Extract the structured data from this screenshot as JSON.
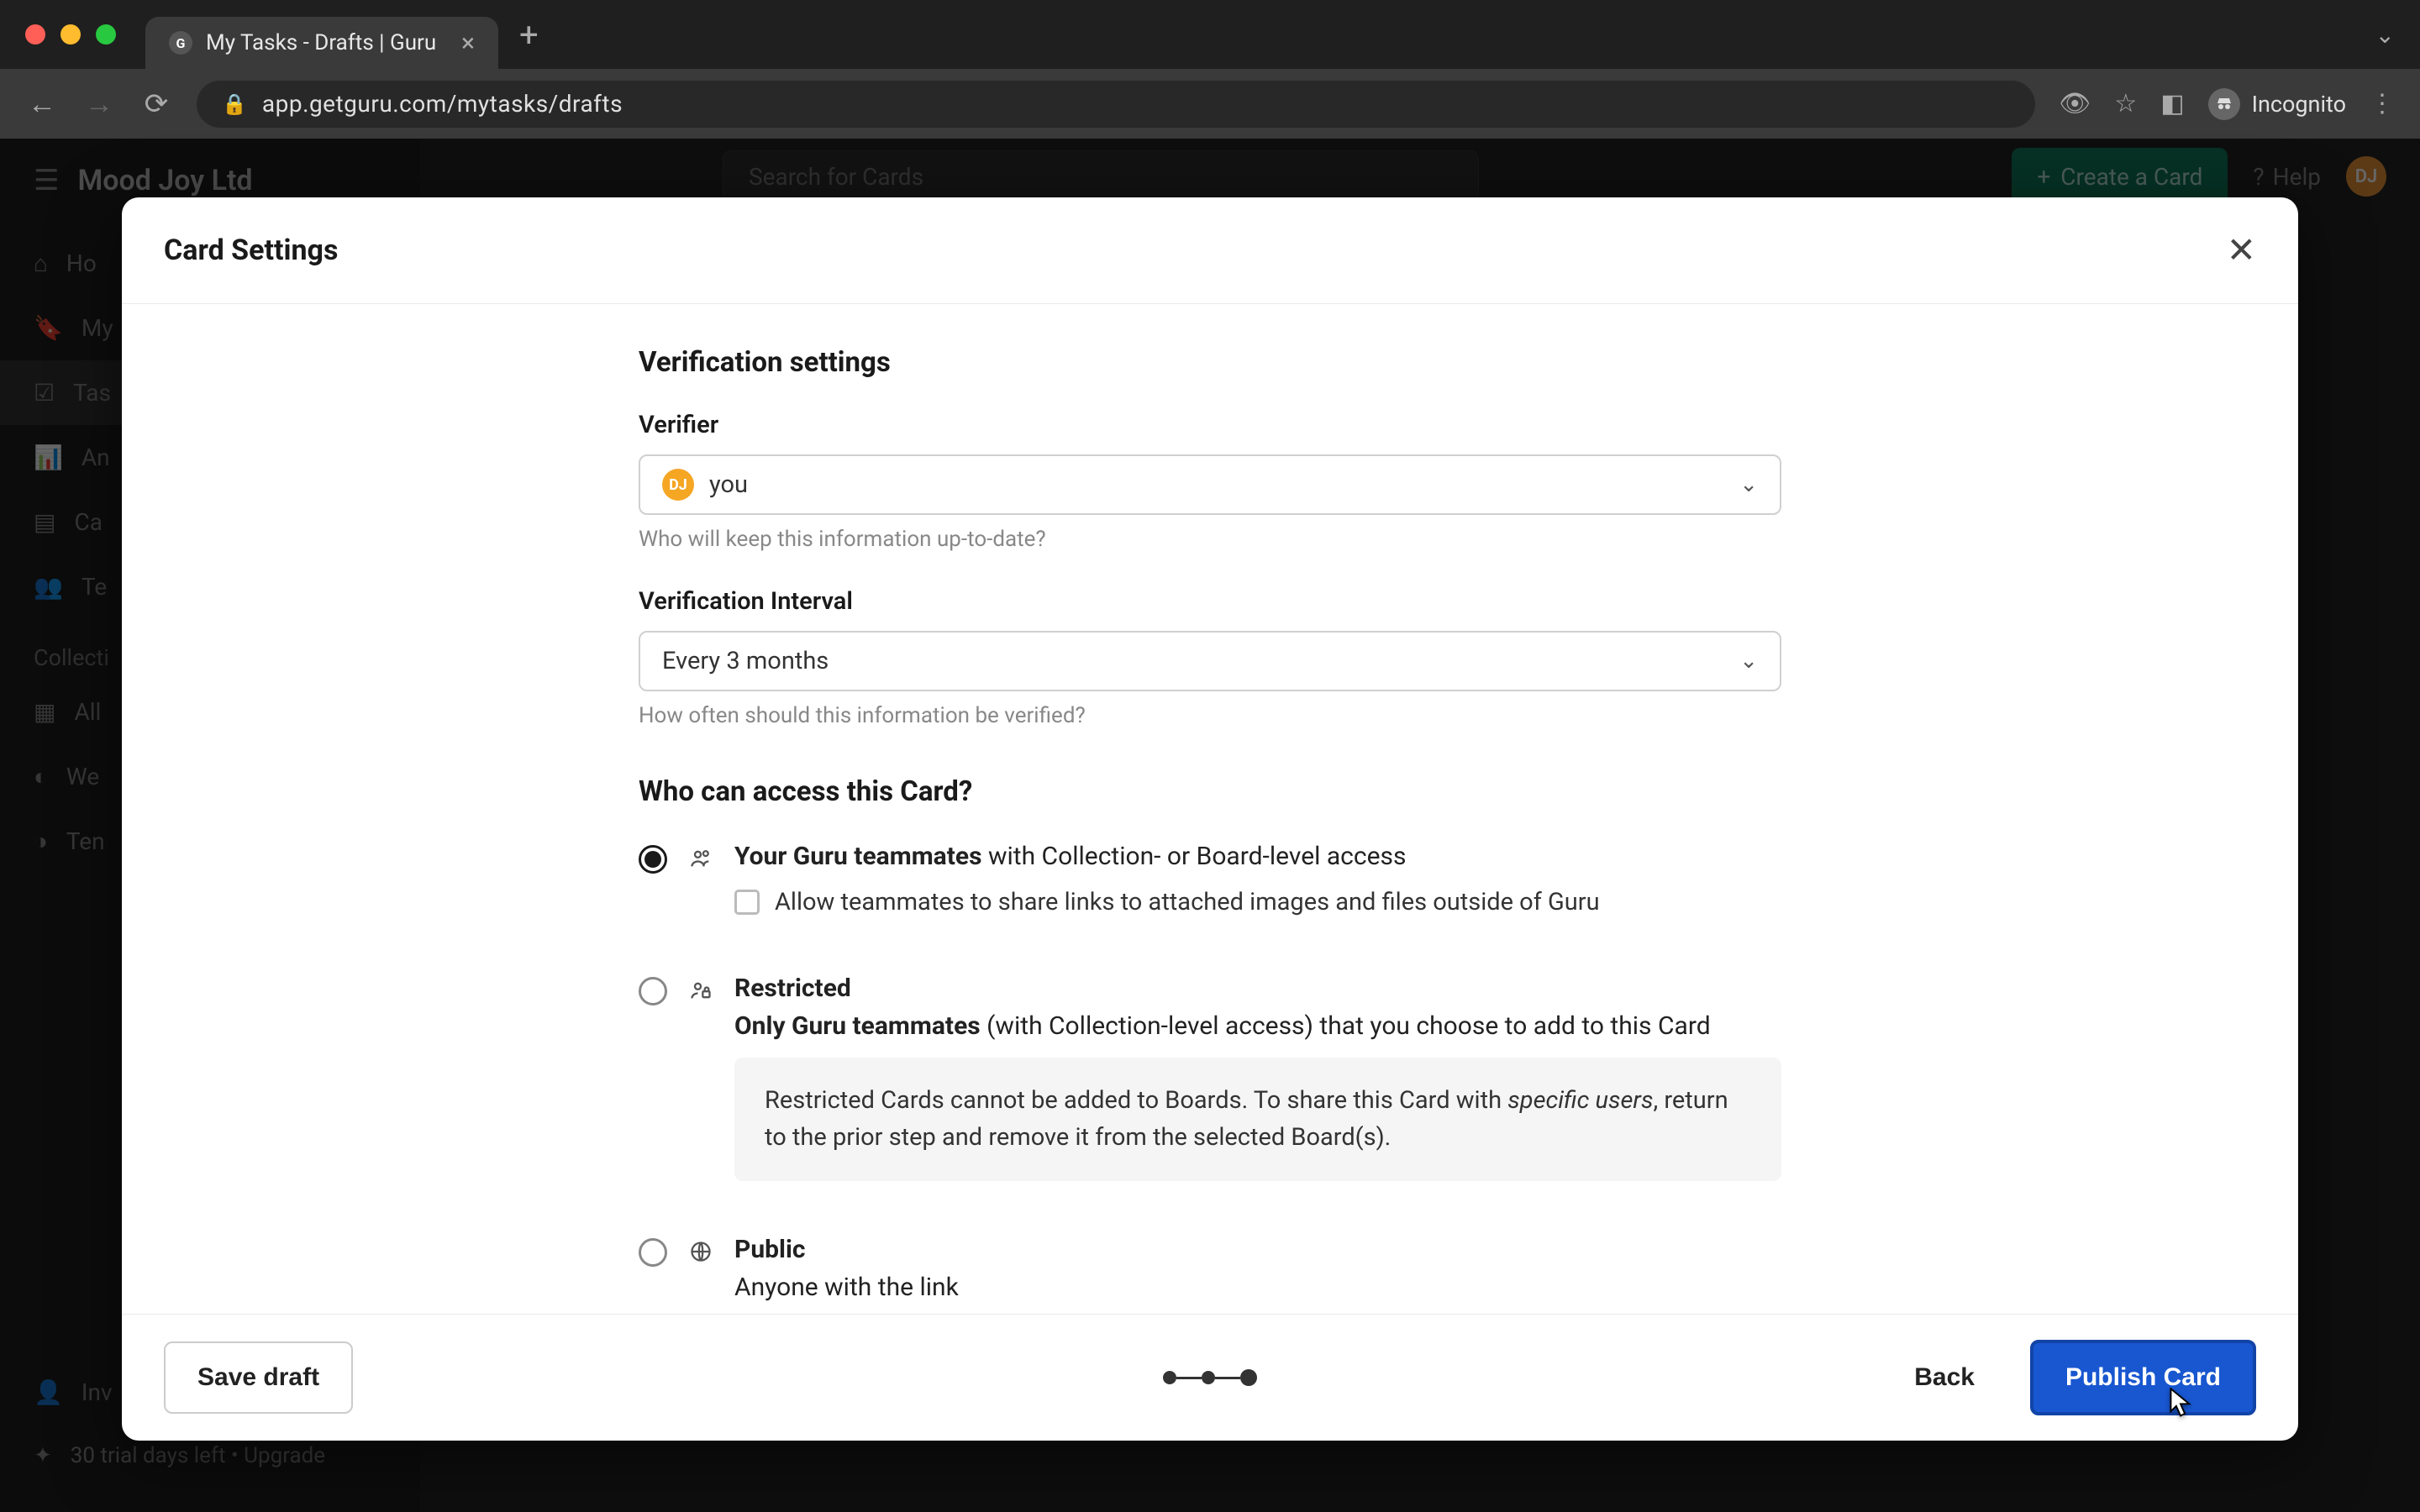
{
  "browser": {
    "tab_title": "My Tasks - Drafts | Guru",
    "favicon_letter": "G",
    "url": "app.getguru.com/mytasks/drafts",
    "incognito_label": "Incognito"
  },
  "app": {
    "brand": "Mood Joy Ltd",
    "search_placeholder": "Search for Cards",
    "create_label": "Create a Card",
    "help_label": "Help",
    "avatar_initials": "DJ",
    "sidebar": {
      "items": [
        {
          "label": "Ho",
          "icon": "home"
        },
        {
          "label": "My",
          "icon": "bookmark"
        },
        {
          "label": "Tas",
          "icon": "check",
          "active": true
        },
        {
          "label": "An",
          "icon": "chart"
        },
        {
          "label": "Ca",
          "icon": "layers"
        },
        {
          "label": "Te",
          "icon": "users"
        }
      ],
      "section_label": "Collecti",
      "coll_items": [
        {
          "label": "All",
          "icon": "grid"
        },
        {
          "label": "We",
          "icon": "circle"
        },
        {
          "label": "Ten",
          "icon": "circle"
        }
      ],
      "invite_label": "Inv",
      "upgrade_label": "30 trial days left • Upgrade"
    }
  },
  "modal": {
    "title": "Card Settings",
    "verification": {
      "section_title": "Verification settings",
      "verifier_label": "Verifier",
      "verifier_value": "you",
      "verifier_initials": "DJ",
      "verifier_hint": "Who will keep this information up-to-date?",
      "interval_label": "Verification Interval",
      "interval_value": "Every 3 months",
      "interval_hint": "How often should this information be verified?"
    },
    "access": {
      "title": "Who can access this Card?",
      "opt1_strong": "Your Guru teammates",
      "opt1_rest": " with Collection- or Board-level access",
      "opt1_sub_label": "Allow teammates to share links to attached images and files outside of Guru",
      "opt2_title": "Restricted",
      "opt2_strong": "Only Guru teammates",
      "opt2_rest": " (with Collection-level access) that you choose to add to this Card",
      "opt2_note_pre": "Restricted Cards cannot be added to Boards. To share this Card with ",
      "opt2_note_em": "specific users",
      "opt2_note_post": ", return to the prior step and remove it from the selected Board(s).",
      "opt3_title": "Public",
      "opt3_sub": "Anyone with the link"
    },
    "footer": {
      "save_draft": "Save draft",
      "back": "Back",
      "publish": "Publish Card"
    }
  }
}
